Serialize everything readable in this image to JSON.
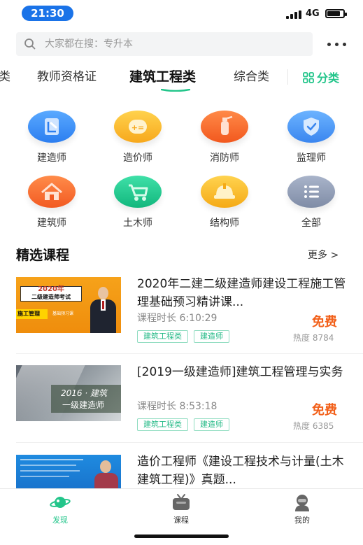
{
  "status_bar": {
    "time": "21:30",
    "network": "4G"
  },
  "search": {
    "placeholder": "大家都在搜：专升本"
  },
  "tabs": [
    {
      "label": "类"
    },
    {
      "label": "教师资格证"
    },
    {
      "label": "建筑工程类"
    },
    {
      "label": "综合类"
    }
  ],
  "category_button": {
    "label": "分类"
  },
  "categories": [
    {
      "label": "建造师",
      "icon": "blueprint-icon",
      "color": "#2f8cf5"
    },
    {
      "label": "造价师",
      "icon": "calculator-icon",
      "color": "#f9a825"
    },
    {
      "label": "消防师",
      "icon": "fire-extinguisher-icon",
      "color": "#f46b2a"
    },
    {
      "label": "监理师",
      "icon": "shield-check-icon",
      "color": "#3d8ef0"
    },
    {
      "label": "建筑师",
      "icon": "house-icon",
      "color": "#f4682a"
    },
    {
      "label": "土木师",
      "icon": "wheelbarrow-icon",
      "color": "#1ec28b"
    },
    {
      "label": "结构师",
      "icon": "hard-hat-icon",
      "color": "#f7b21d"
    },
    {
      "label": "全部",
      "icon": "list-icon",
      "color": "#8f9bb3"
    }
  ],
  "section": {
    "title": "精选课程",
    "more": "更多 >"
  },
  "courses": [
    {
      "title": "2020年二建二级建造师建设工程施工管理基础预习精讲课...",
      "duration": "课程时长 6:10:29",
      "tags": [
        "建筑工程类",
        "建造师"
      ],
      "price": "免费",
      "heat": "热度 8784",
      "thumb": {
        "line1": "2020年",
        "line2": "二级建造师考试",
        "line3": "施工管理",
        "line4": "基础预习课"
      }
    },
    {
      "title": "[2019一级建造师]建筑工程管理与实务",
      "duration": "课程时长 8:53:18",
      "tags": [
        "建筑工程类",
        "建造师"
      ],
      "price": "免费",
      "heat": "热度 6385",
      "thumb": {
        "line1": "2016 · 建筑",
        "line2": "一级建造师"
      }
    },
    {
      "title": "造价工程师《建设工程技术与计量(土木建筑工程)》真题...",
      "duration": "",
      "tags": [],
      "price": "",
      "heat": "",
      "thumb": {}
    }
  ],
  "bottom_nav": [
    {
      "label": "发现",
      "icon": "planet-icon",
      "active": true
    },
    {
      "label": "课程",
      "icon": "tv-icon",
      "active": false
    },
    {
      "label": "我的",
      "icon": "user-icon",
      "active": false
    }
  ],
  "colors": {
    "accent": "#22c58a",
    "price": "#f2601a",
    "status_pill": "#1a73e8"
  }
}
